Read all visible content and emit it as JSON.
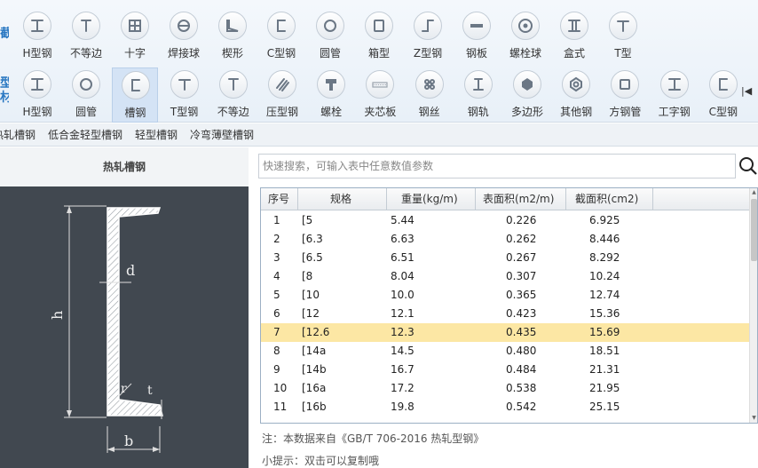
{
  "side_labels": {
    "top": "截",
    "bottom": "型材"
  },
  "toolbar_row1": [
    {
      "label": "H型钢",
      "icon": "h-beam-icon"
    },
    {
      "label": "不等边",
      "icon": "unequal-angle-icon"
    },
    {
      "label": "十字",
      "icon": "cross-section-icon"
    },
    {
      "label": "焊接球",
      "icon": "welded-ball-icon"
    },
    {
      "label": "楔形",
      "icon": "wedge-icon"
    },
    {
      "label": "C型钢",
      "icon": "c-section-icon"
    },
    {
      "label": "圆管",
      "icon": "round-tube-icon"
    },
    {
      "label": "箱型",
      "icon": "box-section-icon"
    },
    {
      "label": "Z型钢",
      "icon": "z-section-icon"
    },
    {
      "label": "钢板",
      "icon": "steel-plate-icon"
    },
    {
      "label": "螺栓球",
      "icon": "bolt-ball-icon"
    },
    {
      "label": "盒式",
      "icon": "box-type-icon"
    },
    {
      "label": "T型",
      "icon": "t-section-icon"
    }
  ],
  "toolbar_row2": [
    {
      "label": "H型钢",
      "icon": "h-beam-icon"
    },
    {
      "label": "圆管",
      "icon": "round-tube-icon"
    },
    {
      "label": "槽钢",
      "icon": "channel-icon",
      "selected": true
    },
    {
      "label": "T型钢",
      "icon": "t-section-icon"
    },
    {
      "label": "不等边",
      "icon": "unequal-angle-icon"
    },
    {
      "label": "压型钢",
      "icon": "profiled-steel-icon"
    },
    {
      "label": "螺栓",
      "icon": "bolt-icon"
    },
    {
      "label": "夹芯板",
      "icon": "sandwich-panel-icon"
    },
    {
      "label": "钢丝",
      "icon": "steel-wire-icon"
    },
    {
      "label": "钢轨",
      "icon": "rail-icon"
    },
    {
      "label": "多边形",
      "icon": "polygon-icon"
    },
    {
      "label": "其他钢",
      "icon": "other-steel-icon"
    },
    {
      "label": "方钢管",
      "icon": "square-tube-icon"
    },
    {
      "label": "工字钢",
      "icon": "i-beam-icon"
    },
    {
      "label": "C型钢",
      "icon": "c-section-icon"
    }
  ],
  "subnav": [
    "热轧槽钢",
    "低合金轻型槽钢",
    "轻型槽钢",
    "冷弯薄壁槽钢"
  ],
  "left_title": "热轧槽钢",
  "diagram_labels": {
    "h": "h",
    "b": "b",
    "d": "d",
    "r": "r",
    "t": "t"
  },
  "search": {
    "placeholder": "快速搜索，可输入表中任意数值参数",
    "value": ""
  },
  "table": {
    "headers": [
      "序号",
      "规格",
      "重量(kg/m)",
      "表面积(m2/m)",
      "截面积(cm2)"
    ],
    "rows": [
      [
        "1",
        "[5",
        "5.44",
        "0.226",
        "6.925"
      ],
      [
        "2",
        "[6.3",
        "6.63",
        "0.262",
        "8.446"
      ],
      [
        "3",
        "[6.5",
        "6.51",
        "0.267",
        "8.292"
      ],
      [
        "4",
        "[8",
        "8.04",
        "0.307",
        "10.24"
      ],
      [
        "5",
        "[10",
        "10.0",
        "0.365",
        "12.74"
      ],
      [
        "6",
        "[12",
        "12.1",
        "0.423",
        "15.36"
      ],
      [
        "7",
        "[12.6",
        "12.3",
        "0.435",
        "15.69"
      ],
      [
        "8",
        "[14a",
        "14.5",
        "0.480",
        "18.51"
      ],
      [
        "9",
        "[14b",
        "16.7",
        "0.484",
        "21.31"
      ],
      [
        "10",
        "[16a",
        "17.2",
        "0.538",
        "21.95"
      ],
      [
        "11",
        "[16b",
        "19.8",
        "0.542",
        "25.15"
      ]
    ],
    "selected_row": 7
  },
  "notes": {
    "source": "注：本数据来自《GB/T 706-2016 热轧型钢》",
    "tip": "小提示：双击可以复制哦"
  },
  "colors": {
    "accent": "#2a78c2",
    "selected_row": "#fce7a4",
    "diagram_bg": "#414850"
  }
}
